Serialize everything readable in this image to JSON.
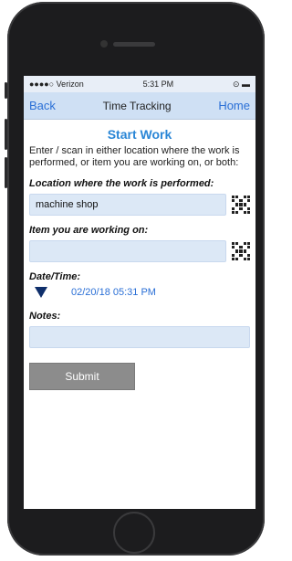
{
  "status_bar": {
    "carrier": "●●●●○ Verizon",
    "time": "5:31 PM",
    "battery_icon": "battery-icon"
  },
  "navbar": {
    "back": "Back",
    "title": "Time Tracking",
    "home": "Home"
  },
  "page": {
    "heading": "Start Work",
    "instructions": "Enter / scan in either location where the work is performed, or item you are working on, or both:"
  },
  "location": {
    "label": "Location where the work is performed:",
    "value": "machine shop"
  },
  "item": {
    "label": "Item you are working on:",
    "value": ""
  },
  "datetime": {
    "label": "Date/Time:",
    "value": "02/20/18 05:31 PM"
  },
  "notes": {
    "label": "Notes:",
    "value": ""
  },
  "actions": {
    "submit": "Submit"
  },
  "colors": {
    "accent": "#2a6fd6",
    "navbar": "#cfe0f4",
    "field": "#dce8f6"
  }
}
